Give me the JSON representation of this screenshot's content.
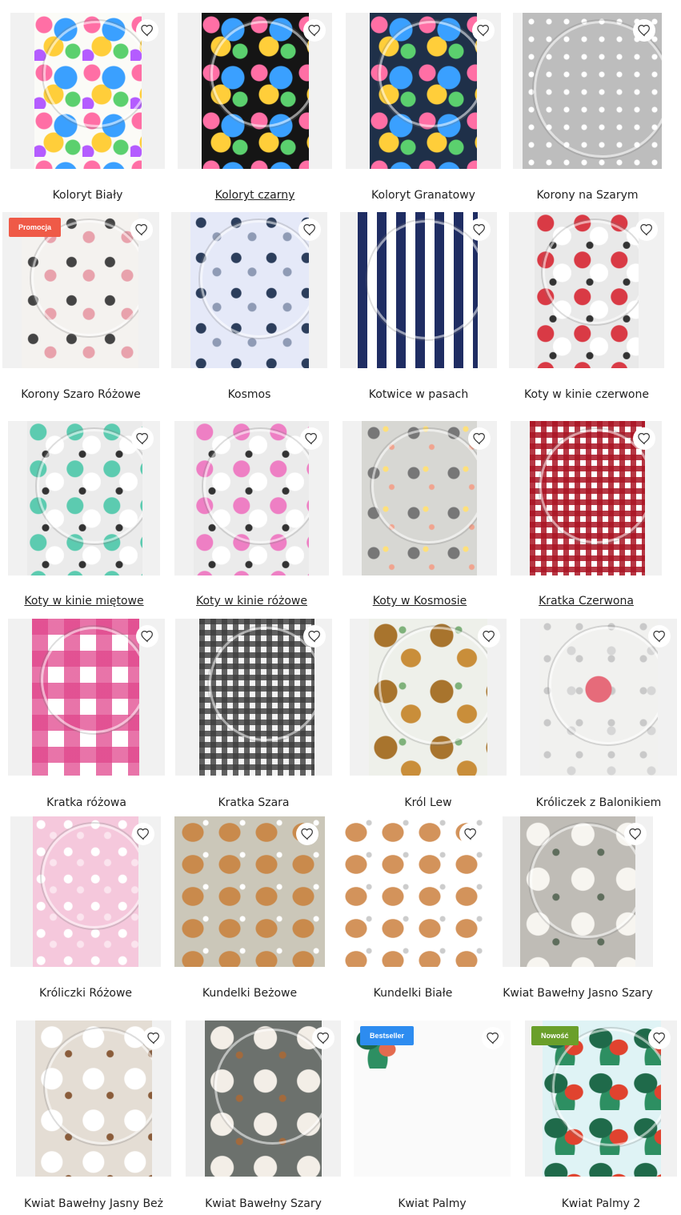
{
  "colors": {
    "promo": "#ef5a47",
    "bestseller": "#2d8cf0",
    "new": "#6a9f2a",
    "tile_bg": "#f1f1f1"
  },
  "products": [
    {
      "name": "Koloryt Biały",
      "badge": "",
      "badge_type": "",
      "underlined": false,
      "pattern": "folk-white"
    },
    {
      "name": "Koloryt czarny",
      "badge": "",
      "badge_type": "",
      "underlined": true,
      "pattern": "folk-black"
    },
    {
      "name": "Koloryt Granatowy",
      "badge": "",
      "badge_type": "",
      "underlined": false,
      "pattern": "folk-navy"
    },
    {
      "name": "Korony na Szarym",
      "badge": "",
      "badge_type": "",
      "underlined": false,
      "pattern": "crowns-grey"
    },
    {
      "name": "Korony Szaro Różowe",
      "badge": "Promocja",
      "badge_type": "promo",
      "underlined": false,
      "pattern": "crowns-pink"
    },
    {
      "name": "Kosmos",
      "badge": "",
      "badge_type": "",
      "underlined": false,
      "pattern": "space"
    },
    {
      "name": "Kotwice w pasach",
      "badge": "",
      "badge_type": "",
      "underlined": false,
      "pattern": "anchors"
    },
    {
      "name": "Koty w kinie czerwone",
      "badge": "",
      "badge_type": "",
      "underlined": false,
      "pattern": "cats-red"
    },
    {
      "name": "Koty w kinie miętowe",
      "badge": "",
      "badge_type": "",
      "underlined": true,
      "pattern": "cats-mint"
    },
    {
      "name": "Koty w kinie różowe",
      "badge": "",
      "badge_type": "",
      "underlined": true,
      "pattern": "cats-pink"
    },
    {
      "name": "Koty w Kosmosie",
      "badge": "",
      "badge_type": "",
      "underlined": true,
      "pattern": "cats-space"
    },
    {
      "name": "Kratka Czerwona",
      "badge": "",
      "badge_type": "",
      "underlined": true,
      "pattern": "check-red"
    },
    {
      "name": "Kratka różowa",
      "badge": "",
      "badge_type": "",
      "underlined": false,
      "pattern": "check-pink"
    },
    {
      "name": "Kratka Szara",
      "badge": "",
      "badge_type": "",
      "underlined": false,
      "pattern": "check-grey"
    },
    {
      "name": "Król Lew",
      "badge": "",
      "badge_type": "",
      "underlined": false,
      "pattern": "lions"
    },
    {
      "name": "Króliczek z Balonikiem",
      "badge": "",
      "badge_type": "",
      "underlined": false,
      "pattern": "bunny-balloon"
    },
    {
      "name": "Króliczki Różowe",
      "badge": "",
      "badge_type": "",
      "underlined": false,
      "pattern": "bunnies-pink"
    },
    {
      "name": "Kundelki Beżowe",
      "badge": "",
      "badge_type": "",
      "underlined": false,
      "pattern": "dogs-beige"
    },
    {
      "name": "Kundelki Białe",
      "badge": "",
      "badge_type": "",
      "underlined": false,
      "pattern": "dogs-white"
    },
    {
      "name": "Kwiat Bawełny Jasno Szary",
      "badge": "",
      "badge_type": "",
      "underlined": false,
      "pattern": "cotton-lightgrey"
    },
    {
      "name": "Kwiat Bawełny Jasny Beż",
      "badge": "",
      "badge_type": "",
      "underlined": false,
      "pattern": "cotton-beige"
    },
    {
      "name": "Kwiat Bawełny Szary",
      "badge": "",
      "badge_type": "",
      "underlined": false,
      "pattern": "cotton-grey"
    },
    {
      "name": "Kwiat Palmy",
      "badge": "Bestseller",
      "badge_type": "bestseller",
      "underlined": false,
      "pattern": "palm-white"
    },
    {
      "name": "Kwiat Palmy 2",
      "badge": "Nowość",
      "badge_type": "new",
      "underlined": false,
      "pattern": "palm-blue"
    }
  ]
}
